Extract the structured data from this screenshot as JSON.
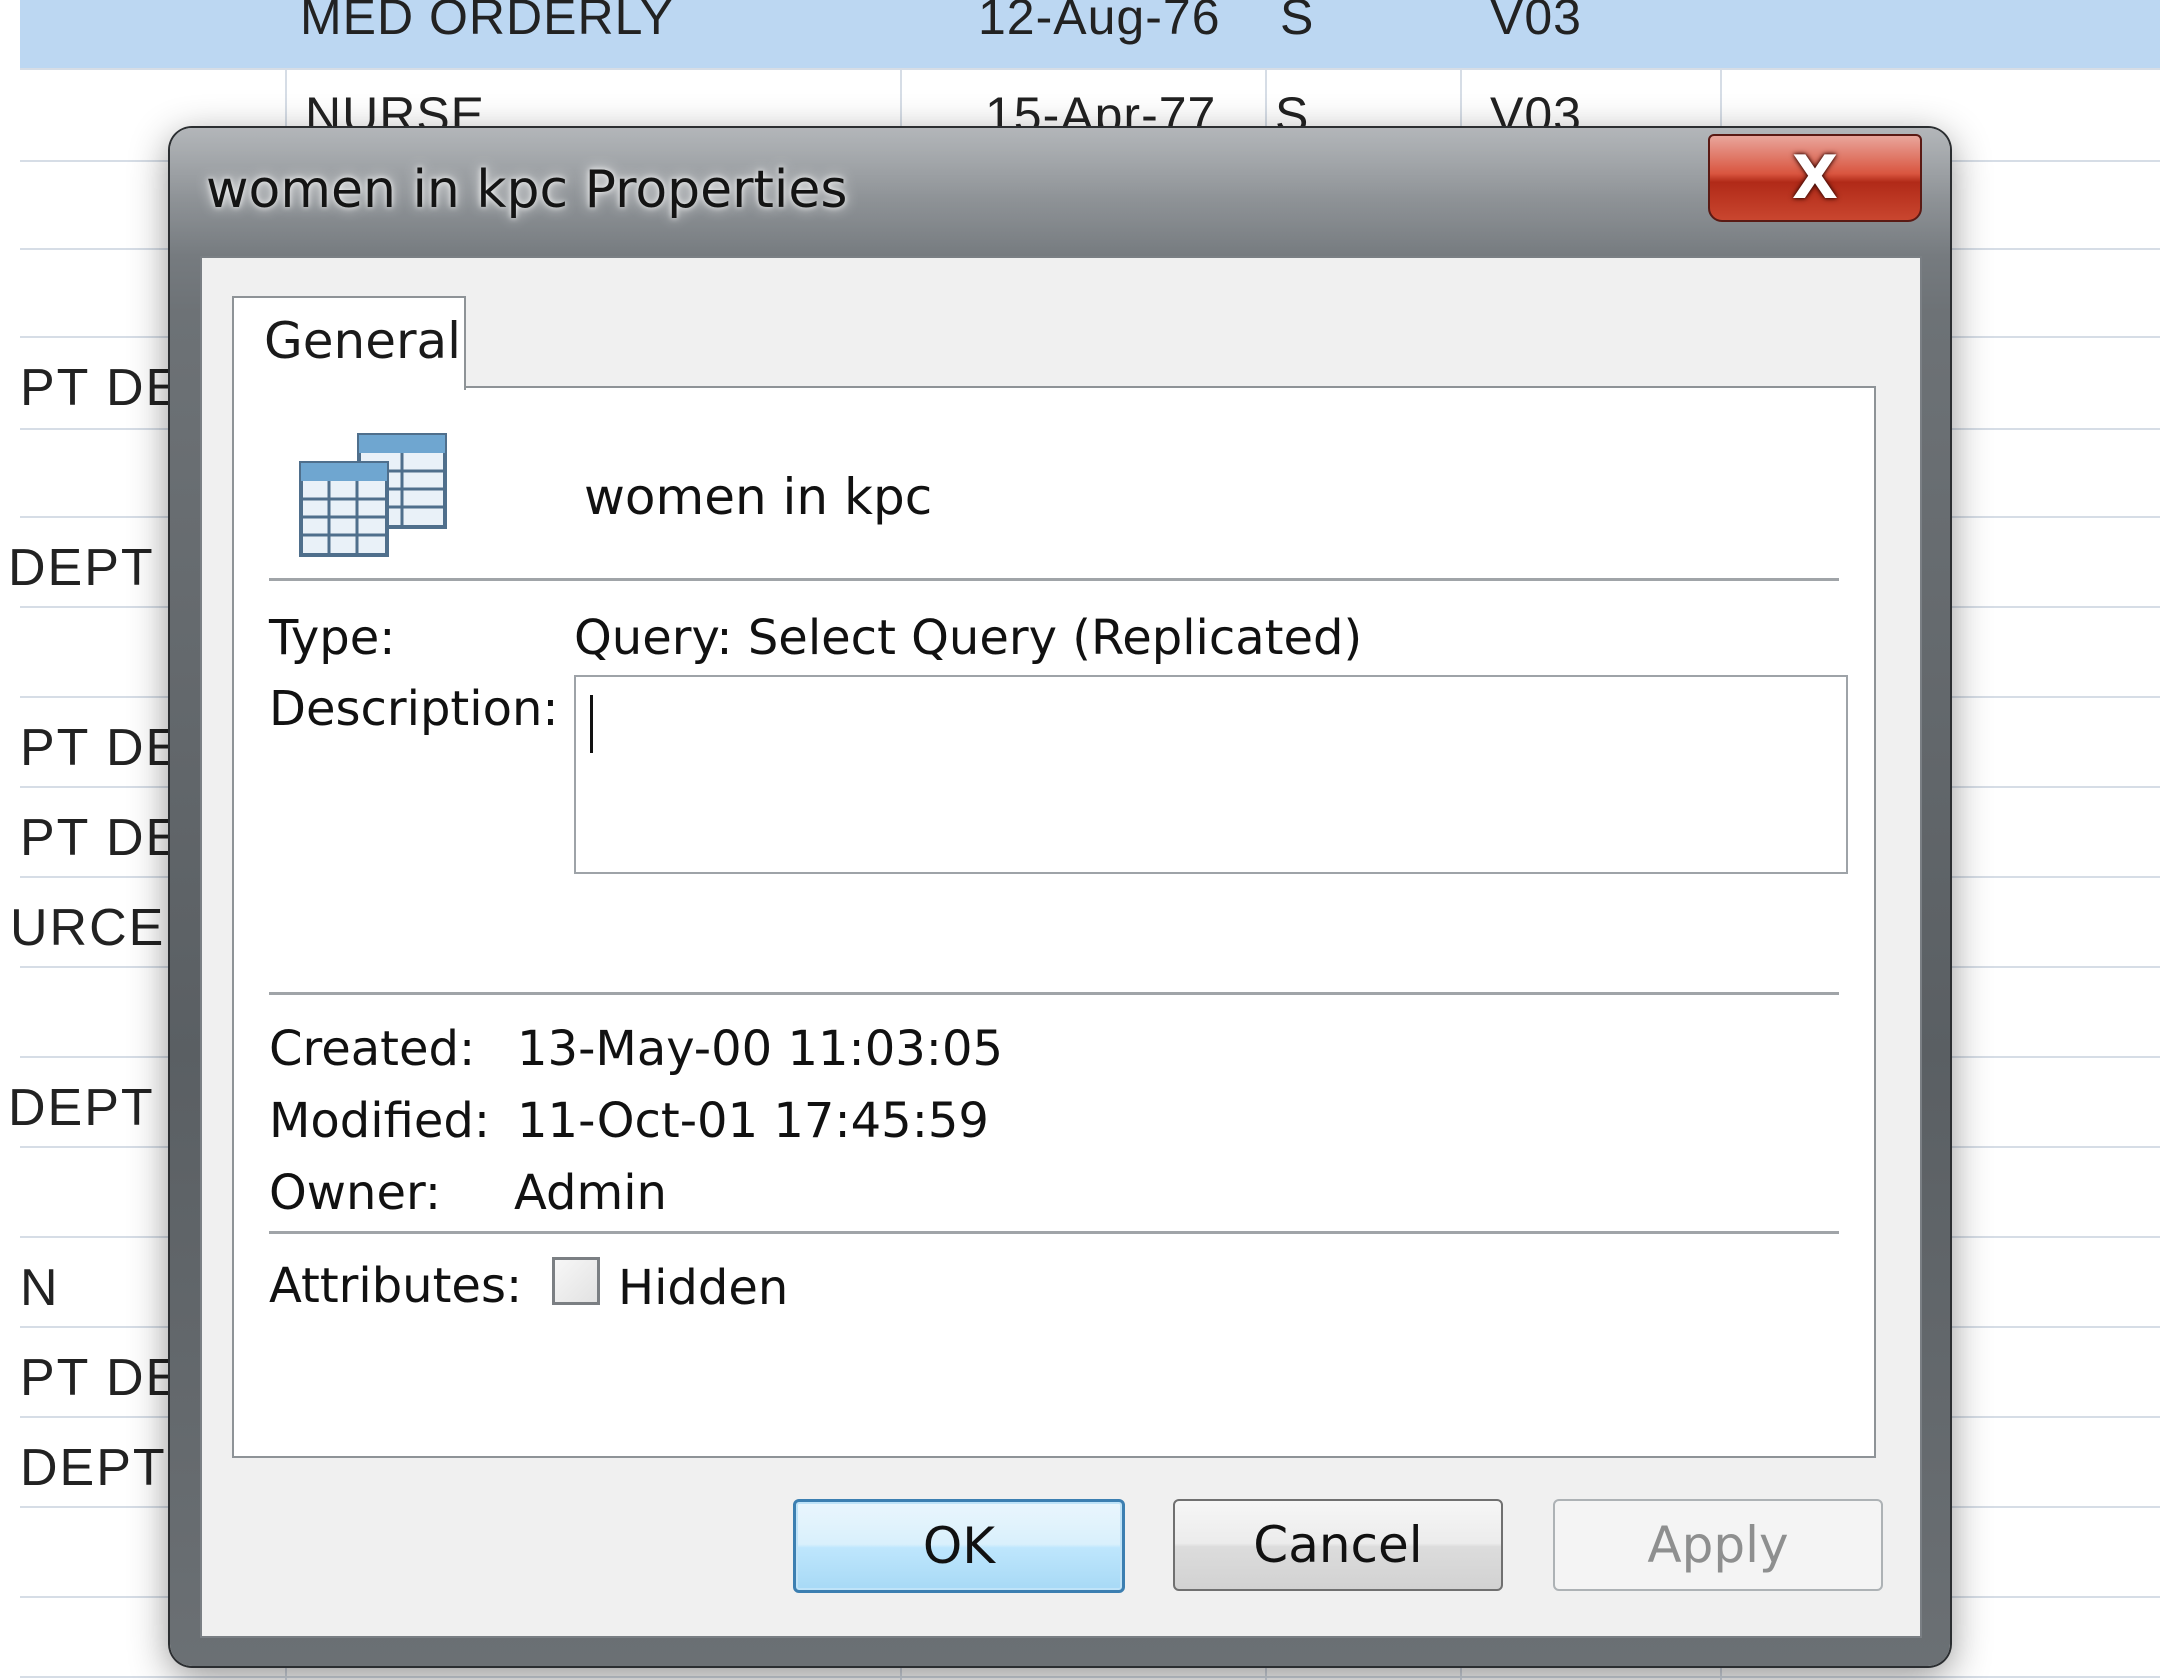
{
  "background_sheet": {
    "top_rows": [
      {
        "col1": "MED ORDERLY",
        "col2": "12-Aug-76",
        "col3": "S",
        "col4": "V03",
        "selected": true
      },
      {
        "col1": "NURSE",
        "col2": "15-Apr-77",
        "col3": "S",
        "col4": "V03",
        "selected": false
      }
    ],
    "left_fragments": [
      "PT DE",
      "DEPT",
      "PT DE",
      "PT DE",
      "URCE",
      "DEPT",
      "N",
      "PT DE",
      "DEPT"
    ]
  },
  "dialog": {
    "title": "women in kpc Properties",
    "close_label": "X",
    "tabs": [
      {
        "label": "General"
      }
    ],
    "object_icon": "table-query-icon",
    "object_name": "women in kpc",
    "type_label": "Type:",
    "type_value": "Query: Select Query (Replicated)",
    "description_label": "Description:",
    "description_value": "",
    "created_label": "Created:",
    "created_value": "13-May-00 11:03:05",
    "modified_label": "Modified:",
    "modified_value": "11-Oct-01 17:45:59",
    "owner_label": "Owner:",
    "owner_value": "Admin",
    "attributes_label": "Attributes:",
    "hidden_label": "Hidden",
    "hidden_checked": false,
    "buttons": {
      "ok": "OK",
      "cancel": "Cancel",
      "apply": "Apply"
    }
  },
  "colors": {
    "selected_row": "#bcd7f2",
    "close_button": "#c9462f",
    "default_button_border": "#3c7fb1"
  }
}
